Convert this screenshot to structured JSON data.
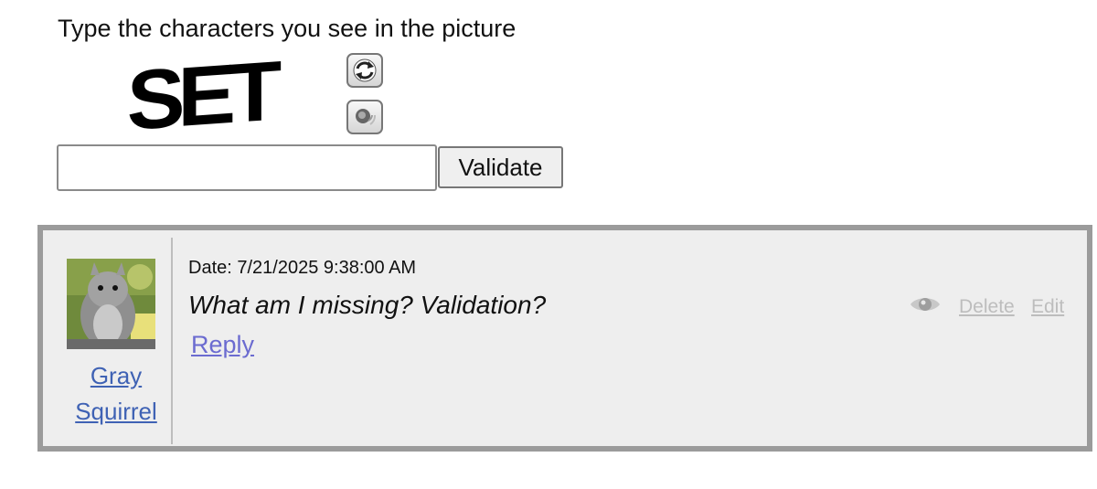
{
  "captcha": {
    "prompt": "Type the characters you see in the picture",
    "image_text": "SET",
    "refresh_icon": "refresh-icon",
    "audio_icon": "speaker-icon",
    "input_value": "",
    "validate_label": "Validate"
  },
  "comment": {
    "author": "Gray Squirrel",
    "date": "Date: 7/21/2025 9:38:00 AM",
    "text": "What am I missing? Validation?",
    "reply_label": "Reply",
    "view_icon": "eye-icon",
    "delete_label": "Delete",
    "edit_label": "Edit"
  },
  "colors": {
    "link": "#3f62b4",
    "reply_link": "#6b6bd0",
    "muted_link": "#bdbdbd",
    "panel_bg": "#eeeeee",
    "panel_border": "#9b9b9b"
  }
}
